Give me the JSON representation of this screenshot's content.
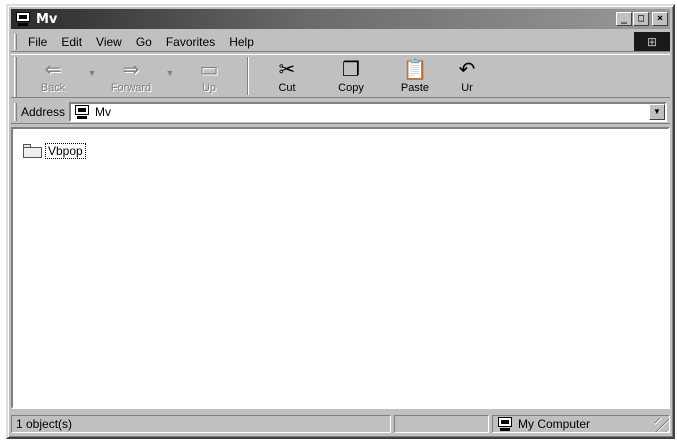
{
  "window": {
    "title": "Mv",
    "buttons": {
      "minimize": "_",
      "maximize": "□",
      "close": "×"
    }
  },
  "menu": {
    "items": [
      "File",
      "Edit",
      "View",
      "Go",
      "Favorites",
      "Help"
    ]
  },
  "toolbar": {
    "back": {
      "label": "Back",
      "icon": "back-arrow-icon"
    },
    "forward": {
      "label": "Forward",
      "icon": "forward-arrow-icon"
    },
    "up": {
      "label": "Up",
      "icon": "up-folder-icon"
    },
    "cut": {
      "label": "Cut",
      "icon": "scissors-icon"
    },
    "copy": {
      "label": "Copy",
      "icon": "copy-icon"
    },
    "paste": {
      "label": "Paste",
      "icon": "paste-icon"
    },
    "undo": {
      "label": "Ur",
      "icon": "undo-icon"
    }
  },
  "address": {
    "label": "Address",
    "value": "Mv",
    "icon": "computer-icon"
  },
  "content": {
    "items": [
      {
        "name": "Vbpop",
        "icon": "folder-icon"
      }
    ]
  },
  "status": {
    "objects": "1 object(s)",
    "location": "My Computer"
  },
  "colors": {
    "face": "#c0c0c0",
    "highlight": "#ffffff",
    "shadow": "#808080",
    "title_bar": "#2b2b2b"
  }
}
